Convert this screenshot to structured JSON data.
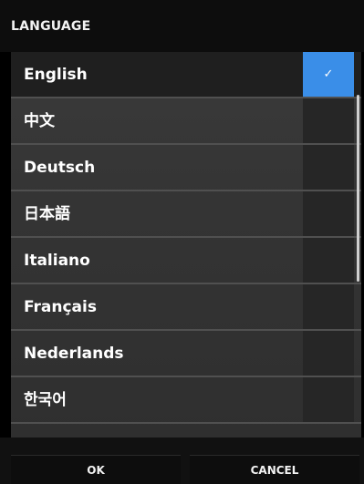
{
  "header": {
    "title": "LANGUAGE"
  },
  "languages": [
    {
      "label": "English",
      "selected": true
    },
    {
      "label": "中文",
      "selected": false
    },
    {
      "label": "Deutsch",
      "selected": false
    },
    {
      "label": "日本語",
      "selected": false
    },
    {
      "label": "Italiano",
      "selected": false
    },
    {
      "label": "Français",
      "selected": false
    },
    {
      "label": "Nederlands",
      "selected": false
    },
    {
      "label": "한국어",
      "selected": false
    }
  ],
  "selected_check": "✓",
  "accent_color": "#3a8ee8",
  "buttons": {
    "ok_label": "OK",
    "cancel_label": "CANCEL"
  }
}
